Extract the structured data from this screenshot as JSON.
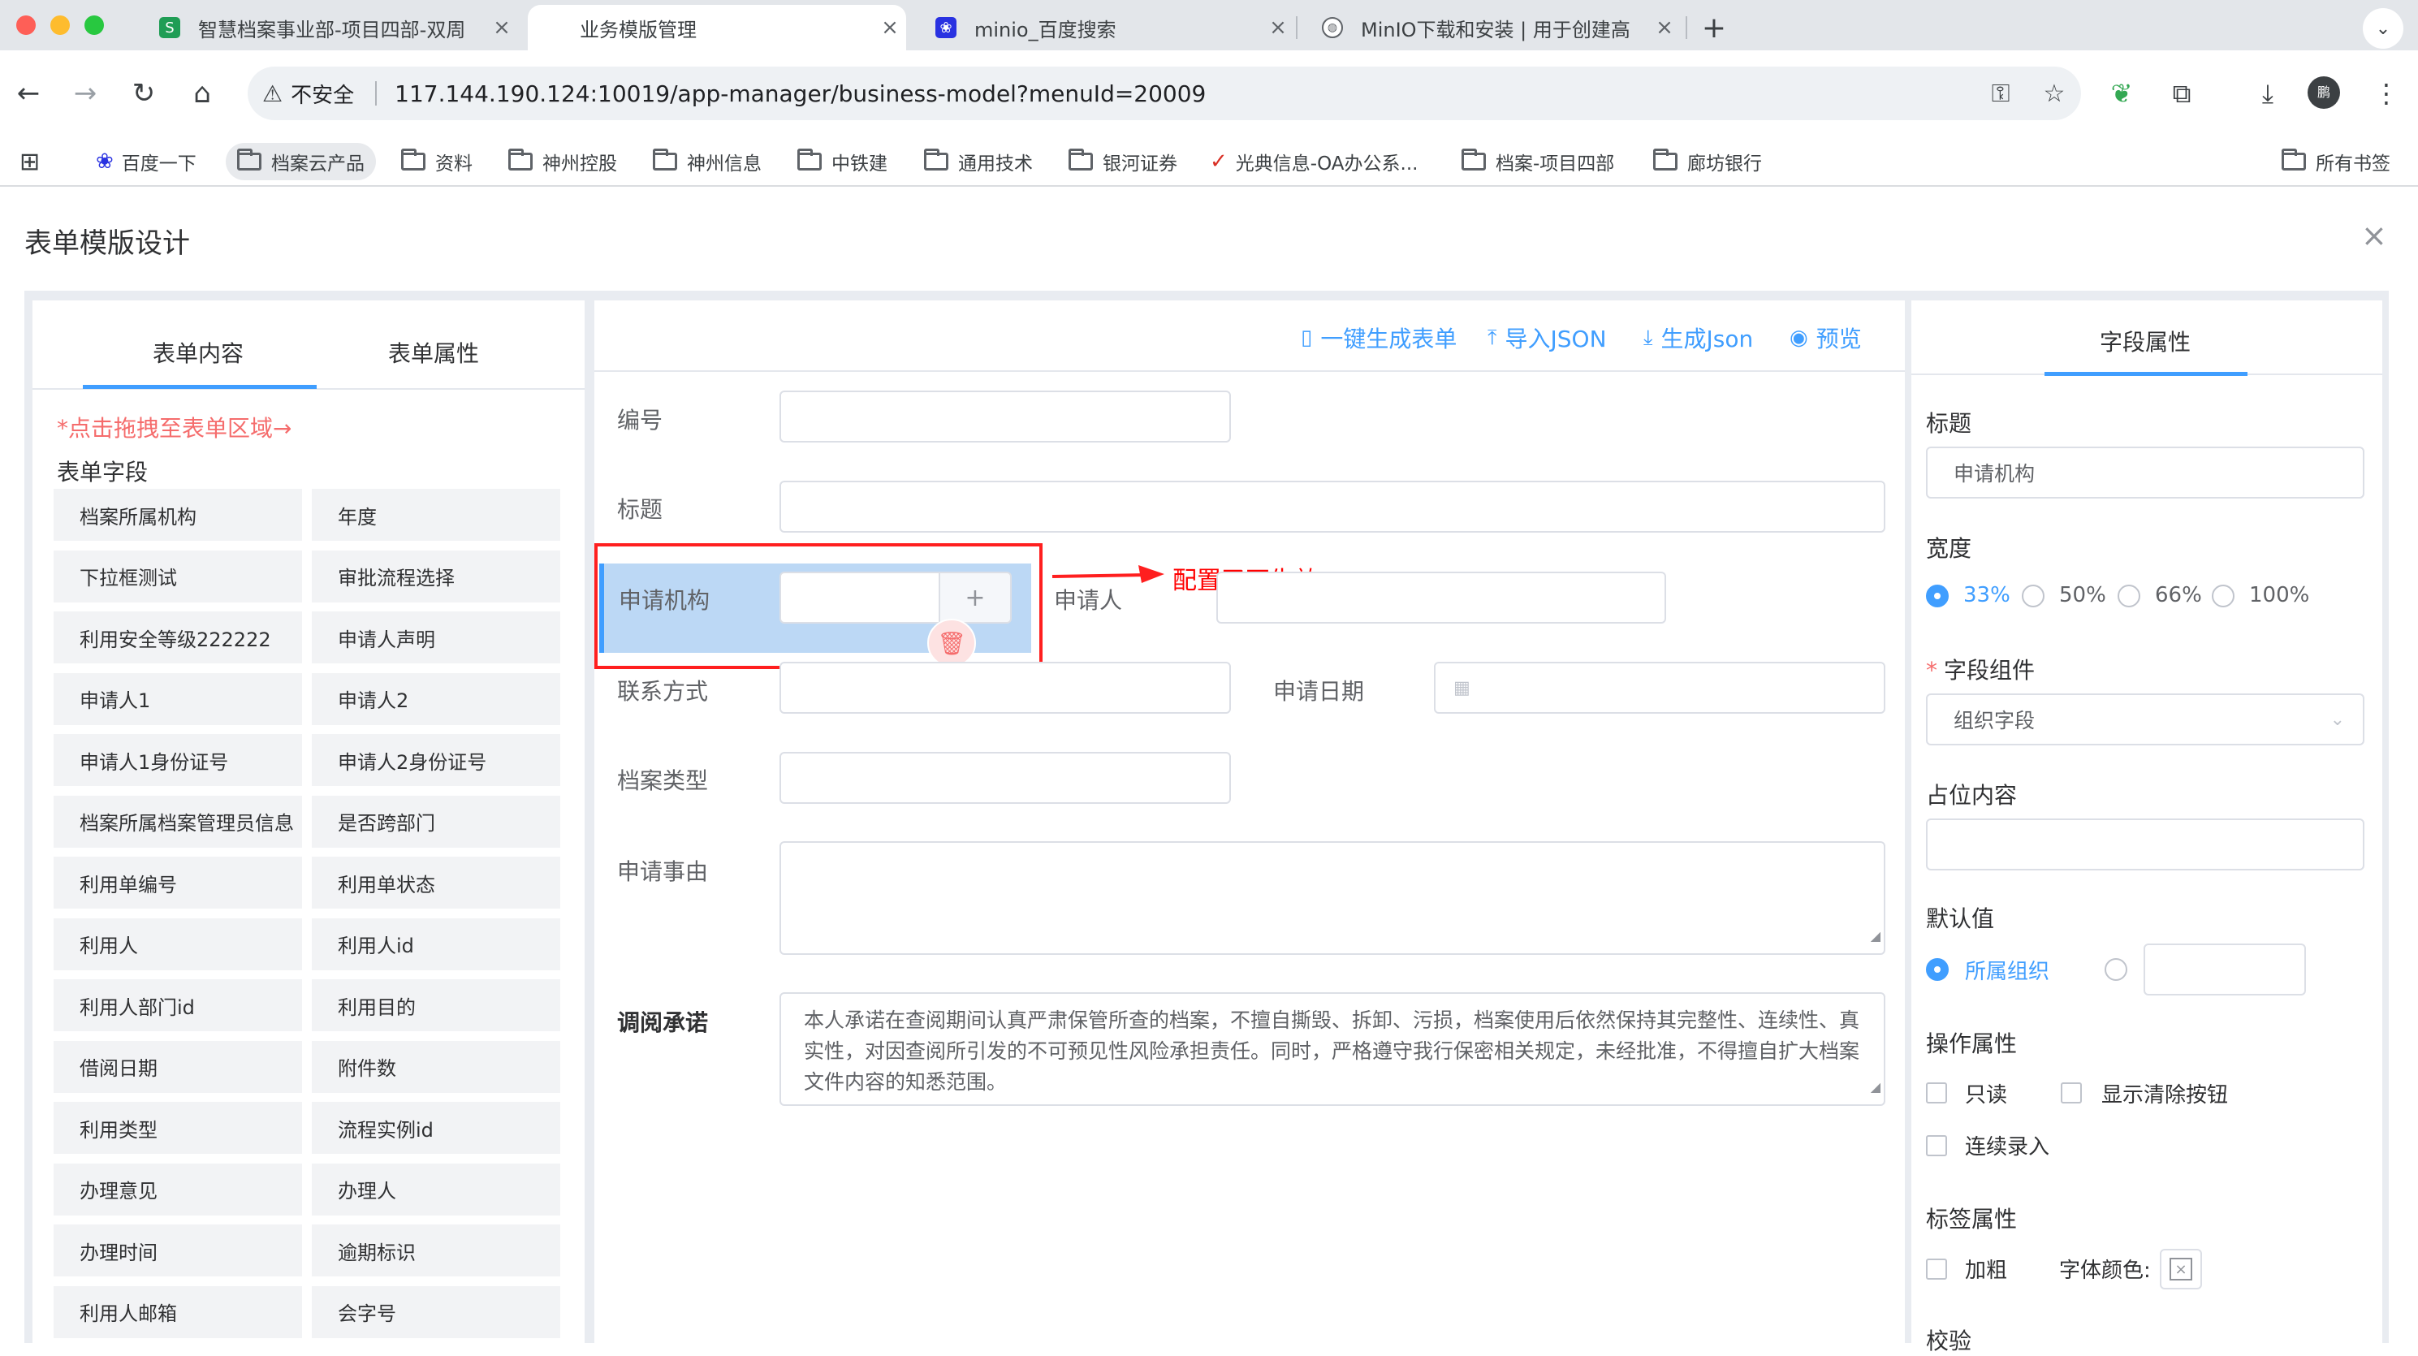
{
  "browser": {
    "tabs": [
      {
        "title": "智慧档案事业部-项目四部-双周",
        "favicon": "sheet-icon",
        "active": false
      },
      {
        "title": "业务模版管理",
        "favicon": "",
        "active": true
      },
      {
        "title": "minio_百度搜索",
        "favicon": "baidu-icon",
        "active": false
      },
      {
        "title": "MinIO下载和安装 | 用于创建高",
        "favicon": "globe-icon",
        "active": false
      }
    ],
    "insecure_label": "不安全",
    "url": "117.144.190.124:10019/app-manager/business-model?menuId=20009",
    "profile_initial": "鹏",
    "bookmarks": [
      "百度一下",
      "档案云产品",
      "资料",
      "神州控股",
      "神州信息",
      "中铁建",
      "通用技术",
      "银河证券",
      "光典信息-OA办公系...",
      "档案-项目四部",
      "廊坊银行"
    ],
    "all_bookmarks": "所有书签"
  },
  "page": {
    "title": "表单模版设计"
  },
  "left_panel": {
    "tabs": [
      "表单内容",
      "表单属性"
    ],
    "drag_hint": "*点击拖拽至表单区域→",
    "section_title": "表单字段",
    "fields": [
      "档案所属机构",
      "年度",
      "下拉框测试",
      "审批流程选择",
      "利用安全等级222222",
      "申请人声明",
      "申请人1",
      "申请人2",
      "申请人1身份证号",
      "申请人2身份证号",
      "档案所属档案管理员信息",
      "是否跨部门",
      "利用单编号",
      "利用单状态",
      "利用人",
      "利用人id",
      "利用人部门id",
      "利用目的",
      "借阅日期",
      "附件数",
      "利用类型",
      "流程实例id",
      "办理意见",
      "办理人",
      "办理时间",
      "逾期标识",
      "利用人邮箱",
      "会字号"
    ]
  },
  "middle_panel": {
    "actions": [
      "一键生成表单",
      "导入JSON",
      "生成Json",
      "预览"
    ],
    "labels": {
      "number": "编号",
      "title": "标题",
      "org": "申请机构",
      "applicant": "申请人",
      "contact": "联系方式",
      "apply_date": "申请日期",
      "archive_type": "档案类型",
      "reason": "申请事由",
      "promise": "调阅承诺"
    },
    "promise_text": "本人承诺在查阅期间认真严肃保管所查的档案，不擅自撕毁、拆卸、污损，档案使用后依然保持其完整性、连续性、真实性，对因查阅所引发的不可预见性风险承担责任。同时，严格遵守我行保密相关规定，未经批准，不得擅自扩大档案文件内容的知悉范围。",
    "annotation": "配置了不生效"
  },
  "right_panel": {
    "tab": "字段属性",
    "title_label": "标题",
    "title_value": "申请机构",
    "width_label": "宽度",
    "width_options": [
      "33%",
      "50%",
      "66%",
      "100%"
    ],
    "width_selected": "33%",
    "component_label": "字段组件",
    "component_required": "*",
    "component_value": "组织字段",
    "placeholder_label": "占位内容",
    "placeholder_value": "",
    "default_label": "默认值",
    "default_option": "所属组织",
    "ops_label": "操作属性",
    "ops": [
      "只读",
      "显示清除按钮",
      "连续录入"
    ],
    "tag_label": "标签属性",
    "bold_label": "加粗",
    "font_color_label": "字体颜色:",
    "validate_label": "校验"
  },
  "colors": {
    "primary": "#409eff",
    "danger": "#f56c6c",
    "annotation_red": "#ff1f1f",
    "selected_bg": "#bcd8f5"
  }
}
